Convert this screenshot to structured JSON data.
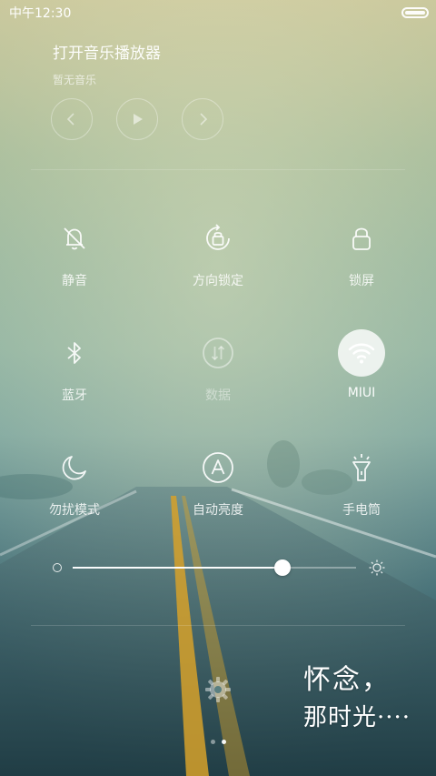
{
  "status_bar": {
    "time": "中午12:30"
  },
  "music": {
    "title": "打开音乐播放器",
    "subtitle": "暂无音乐",
    "controls": [
      "previous",
      "play",
      "next"
    ]
  },
  "toggles": [
    {
      "label": "静音",
      "icon": "mute-bell-icon",
      "state": "off"
    },
    {
      "label": "方向锁定",
      "icon": "rotation-lock-icon",
      "state": "off"
    },
    {
      "label": "锁屏",
      "icon": "lock-icon",
      "state": "off"
    },
    {
      "label": "蓝牙",
      "icon": "bluetooth-icon",
      "state": "off"
    },
    {
      "label": "数据",
      "icon": "mobile-data-icon",
      "state": "disabled"
    },
    {
      "label": "MIUI",
      "icon": "wifi-icon",
      "state": "on"
    },
    {
      "label": "勿扰模式",
      "icon": "moon-icon",
      "state": "off"
    },
    {
      "label": "自动亮度",
      "icon": "auto-brightness-icon",
      "state": "off"
    },
    {
      "label": "手电筒",
      "icon": "flashlight-icon",
      "state": "off"
    }
  ],
  "brightness": {
    "level": 0.74
  },
  "bottom": {
    "settings_icon": "gear-icon",
    "page_count": 2,
    "active_page": 2
  },
  "wallpaper": {
    "line1": "怀念，",
    "line2": "那时光····"
  }
}
